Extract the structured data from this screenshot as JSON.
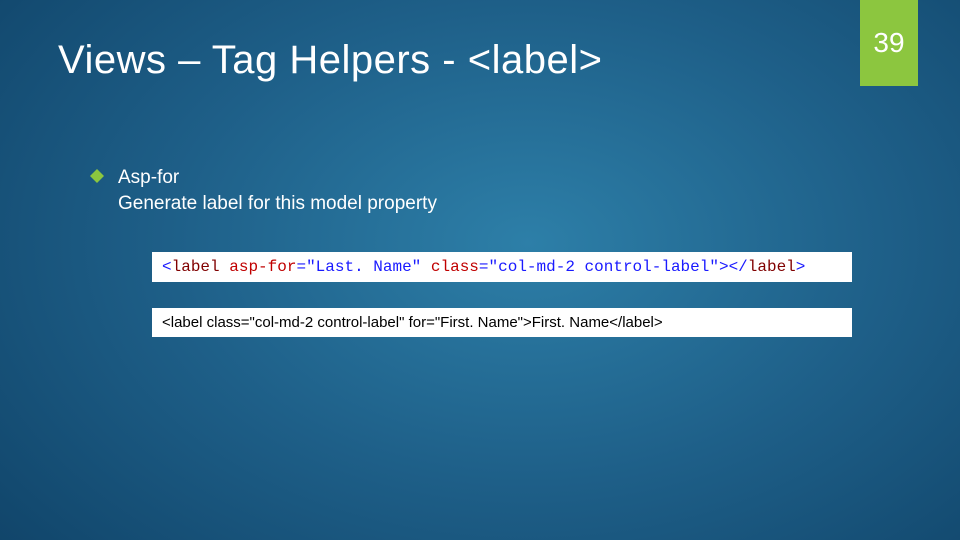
{
  "page_number": "39",
  "title": "Views – Tag Helpers - <label>",
  "bullet": {
    "heading": "Asp-for",
    "desc": "Generate label for this model property"
  },
  "code1": {
    "open_bracket": "<",
    "tag_open": "label",
    "attr1_name": "asp-for",
    "eq": "=",
    "attr1_val": "\"Last. Name\"",
    "attr2_name": "class",
    "attr2_val": "\"col-md-2 control-label\"",
    "close_bracket": ">",
    "open_bracket2": "</",
    "tag_close": "label",
    "close_bracket2": ">"
  },
  "code2": "<label class=\"col-md-2 control-label\" for=\"First. Name\">First. Name</label>"
}
